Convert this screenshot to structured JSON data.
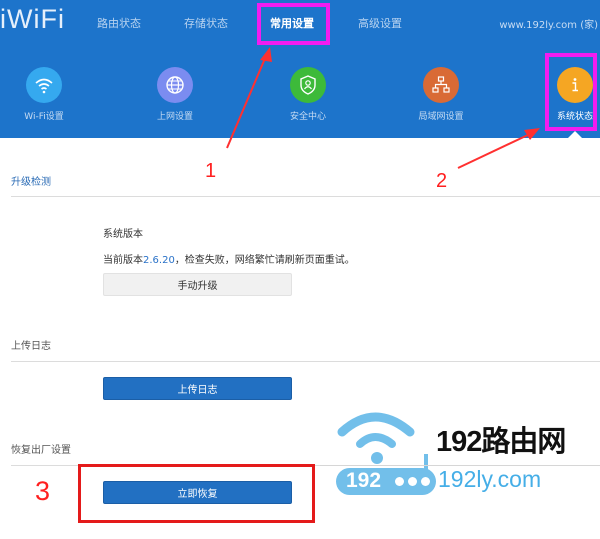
{
  "header": {
    "logo": "iWiFi",
    "nav": [
      {
        "label": "路由状态",
        "active": false
      },
      {
        "label": "存储状态",
        "active": false
      },
      {
        "label": "常用设置",
        "active": true
      },
      {
        "label": "高级设置",
        "active": false
      }
    ],
    "site_text": "www.192ly.com (家)"
  },
  "icon_menu": [
    {
      "label": "Wi-Fi设置",
      "icon": "wifi-icon",
      "color": "#35a9ef"
    },
    {
      "label": "上网设置",
      "icon": "globe-icon",
      "color": "#7b8cf0"
    },
    {
      "label": "安全中心",
      "icon": "shield-user-icon",
      "color": "#3dba3a"
    },
    {
      "label": "局域网设置",
      "icon": "network-icon",
      "color": "#d96a35"
    },
    {
      "label": "系统状态",
      "icon": "info-icon",
      "color": "#f5a623",
      "active": true
    }
  ],
  "sections": {
    "upgrade": {
      "title": "升级检测",
      "system_version_label": "系统版本",
      "status_prefix": "当前版本",
      "version": "2.6.20",
      "status_suffix": "，检查失败，网络繁忙请刷新页面重试。",
      "button": "手动升级"
    },
    "log": {
      "title": "上传日志",
      "button": "上传日志"
    },
    "reset": {
      "title": "恢复出厂设置",
      "button": "立即恢复"
    }
  },
  "annotations": {
    "step1": "1",
    "step2": "2",
    "step3": "3",
    "highlight_color": "#f21cf0",
    "arrow_color": "#ff3030"
  },
  "watermark": {
    "title": "192路由网",
    "badge": "192",
    "url": "192ly.com"
  }
}
